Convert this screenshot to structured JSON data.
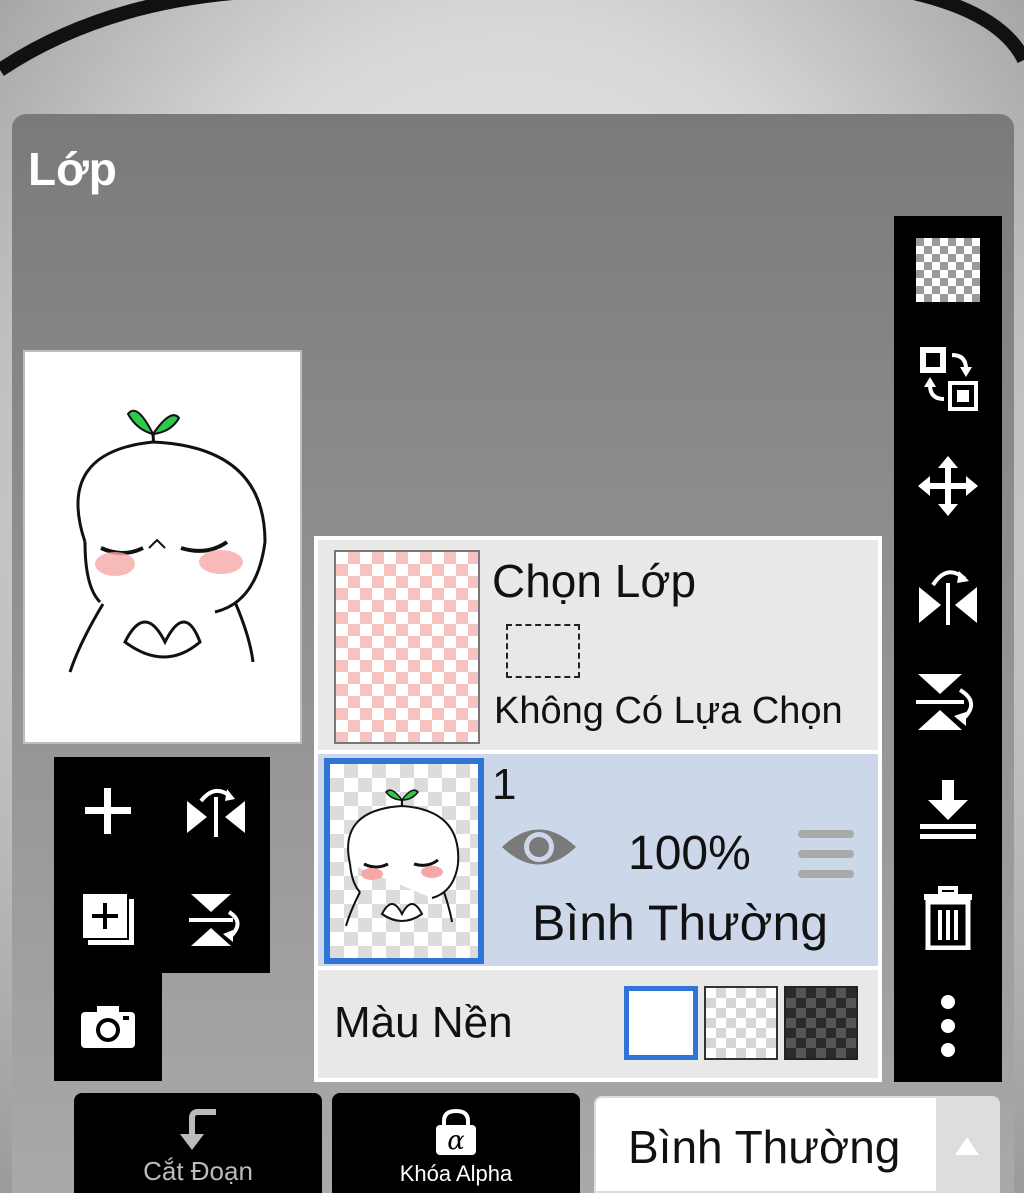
{
  "dialog": {
    "title": "Lớp"
  },
  "selection_row": {
    "title": "Chọn Lớp",
    "subtitle": "Không Có Lựa Chọn"
  },
  "layer_row": {
    "number": "1",
    "opacity": "100%",
    "blend_mode": "Bình Thường",
    "visible": true
  },
  "background_row": {
    "label": "Màu Nền",
    "options": [
      "white",
      "transparent",
      "dark-checker"
    ],
    "selected": "white"
  },
  "bottom_bar": {
    "clipping_label": "Cắt Đoạn",
    "alpha_lock_label": "Khóa Alpha",
    "blend_mode_value": "Bình Thường"
  },
  "toolbar_right": {
    "buttons": [
      "transparency-icon",
      "swap-layer-icon",
      "move-icon",
      "flip-horizontal-icon",
      "flip-vertical-icon",
      "merge-down-icon",
      "trash-icon",
      "more-icon"
    ]
  },
  "tools_left": {
    "buttons": [
      "add-layer-icon",
      "flip-horizontal-icon",
      "add-special-layer-icon",
      "flip-vertical-icon",
      "camera-icon"
    ]
  },
  "colors": {
    "accent": "#2f74d6",
    "selected_row": "#ccd8ea",
    "panel": "#e8e8e8"
  }
}
